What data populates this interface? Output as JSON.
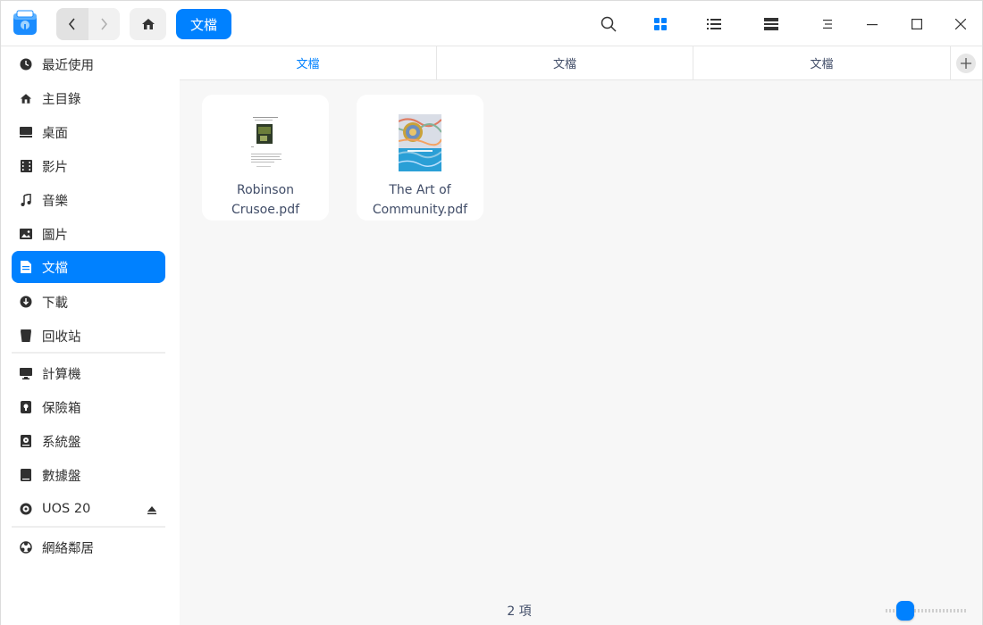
{
  "crumb": {
    "label": "文檔"
  },
  "sidebar": {
    "items": [
      {
        "name": "recent",
        "label": "最近使用",
        "icon": "clock-icon"
      },
      {
        "name": "home",
        "label": "主目錄",
        "icon": "home-icon"
      },
      {
        "name": "desktop",
        "label": "桌面",
        "icon": "desktop-icon"
      },
      {
        "name": "videos",
        "label": "影片",
        "icon": "film-icon"
      },
      {
        "name": "music",
        "label": "音樂",
        "icon": "music-note-icon"
      },
      {
        "name": "pictures",
        "label": "圖片",
        "icon": "image-icon"
      },
      {
        "name": "documents",
        "label": "文檔",
        "icon": "document-icon",
        "active": true
      },
      {
        "name": "downloads",
        "label": "下載",
        "icon": "download-icon"
      },
      {
        "name": "trash",
        "label": "回收站",
        "icon": "trash-icon"
      },
      {
        "name": "computer",
        "label": "計算機",
        "icon": "computer-icon"
      },
      {
        "name": "vault",
        "label": "保險箱",
        "icon": "vault-icon"
      },
      {
        "name": "system-disk",
        "label": "系統盤",
        "icon": "disk-icon"
      },
      {
        "name": "data-disk",
        "label": "數據盤",
        "icon": "drive-icon"
      },
      {
        "name": "uos",
        "label": "UOS 20",
        "icon": "disc-icon"
      },
      {
        "name": "network",
        "label": "網絡鄰居",
        "icon": "network-icon"
      }
    ]
  },
  "tabs": [
    {
      "label": "文檔",
      "active": true
    },
    {
      "label": "文檔",
      "active": false
    },
    {
      "label": "文檔",
      "active": false
    }
  ],
  "files": [
    {
      "line1": "Robinson",
      "line2": "Crusoe.pdf"
    },
    {
      "line1": "The Art of",
      "line2": "Community.pdf"
    }
  ],
  "status": {
    "count": "2 項"
  },
  "colors": {
    "accent": "#0081ff",
    "content_bg": "#f7f7f7"
  }
}
